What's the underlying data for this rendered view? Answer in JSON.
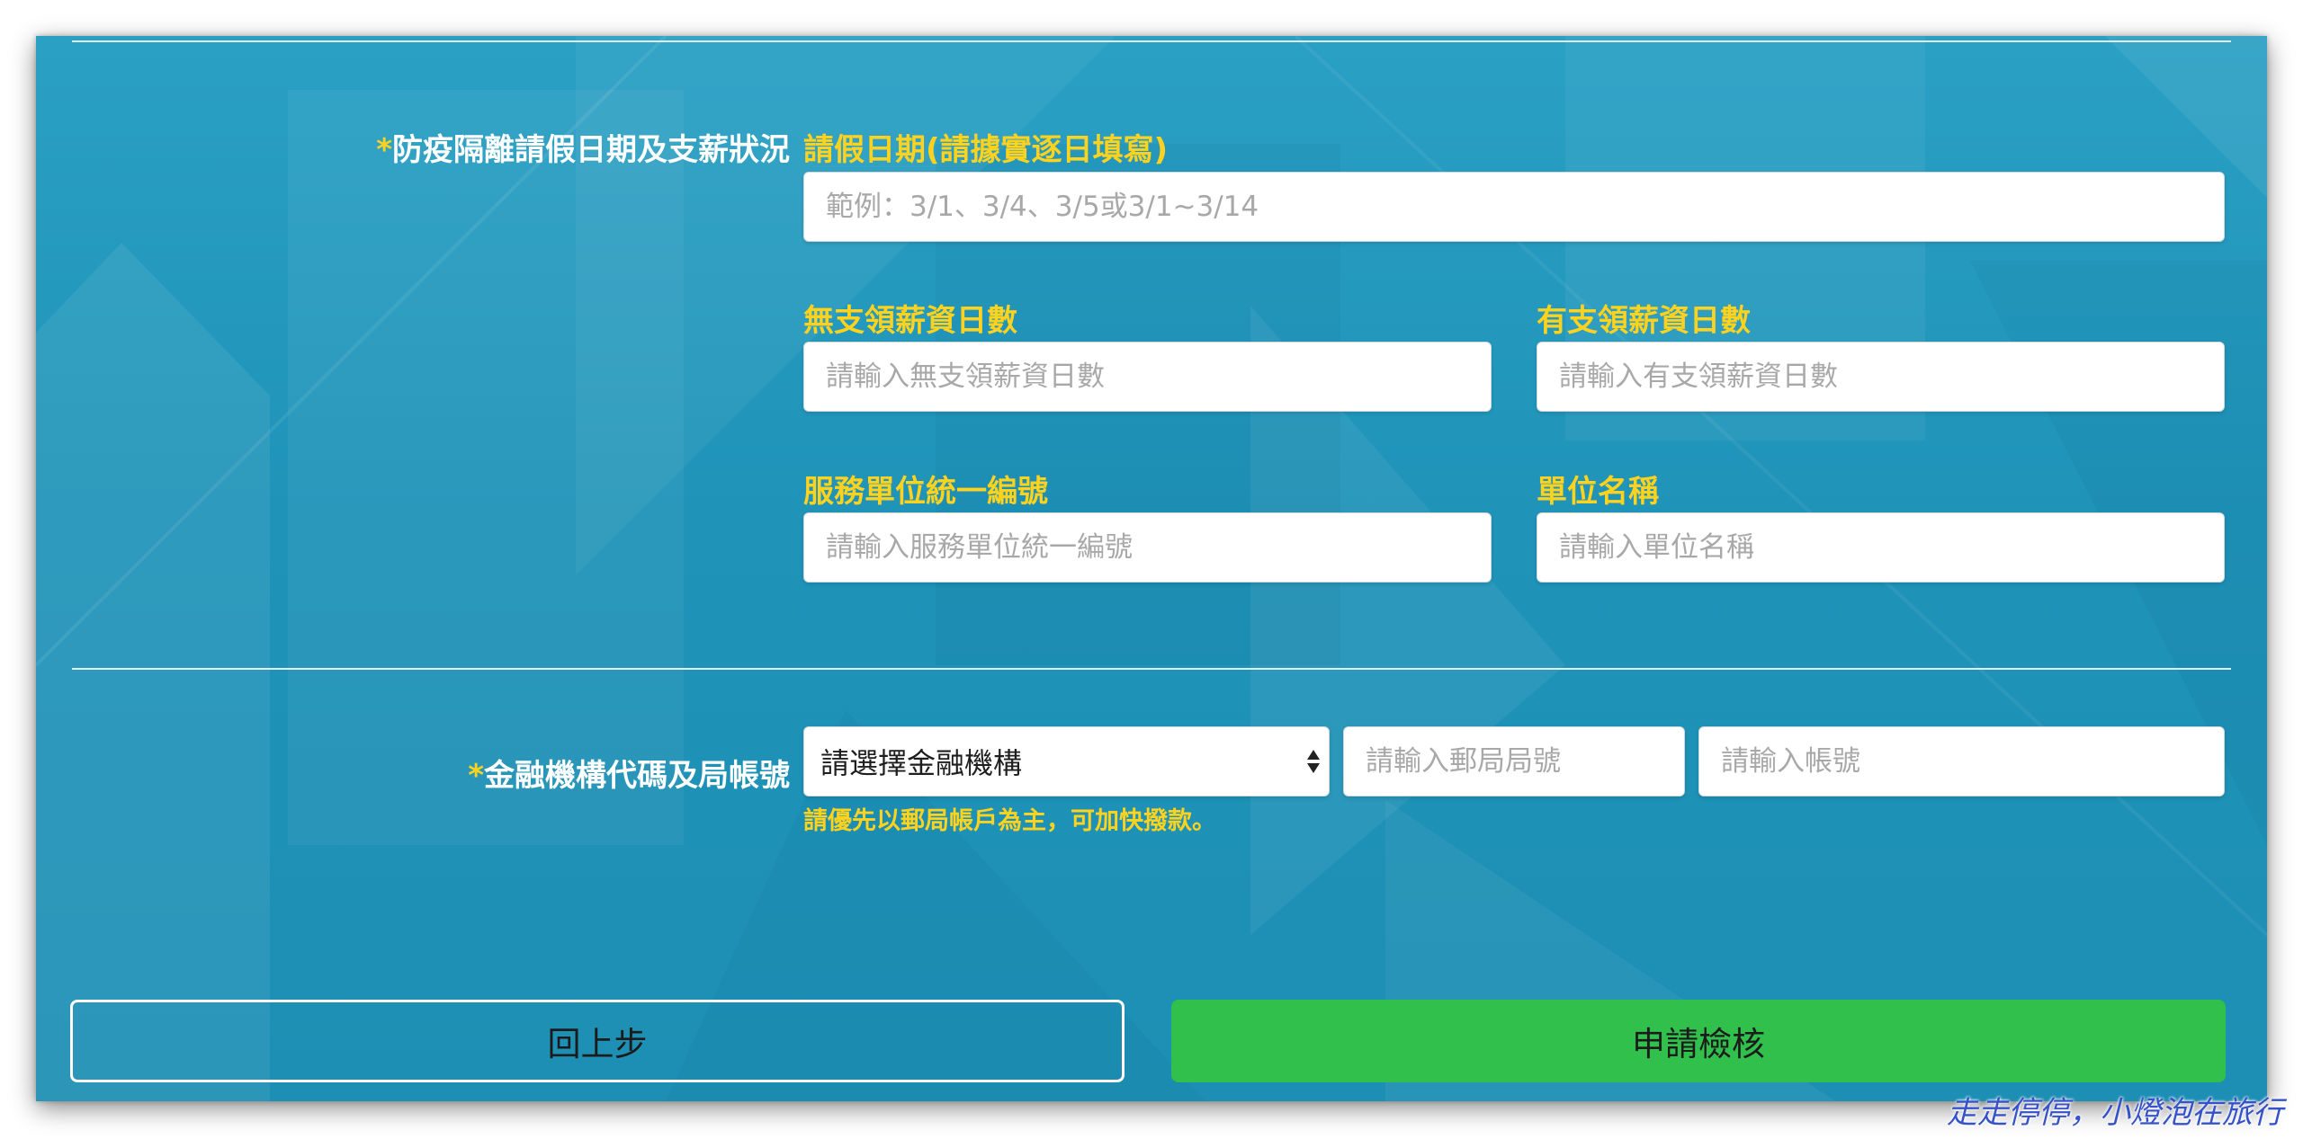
{
  "leave_section": {
    "label_star": "*",
    "label": "防疫隔離請假日期及支薪狀況",
    "dates_label": "請假日期(請據實逐日填寫)",
    "dates_placeholder": "範例：3/1、3/4、3/5或3/1~3/14",
    "unpaid_days_label": "無支領薪資日數",
    "unpaid_days_placeholder": "請輸入無支領薪資日數",
    "paid_days_label": "有支領薪資日數",
    "paid_days_placeholder": "請輸入有支領薪資日數",
    "employer_id_label": "服務單位統一編號",
    "employer_id_placeholder": "請輸入服務單位統一編號",
    "employer_name_label": "單位名稱",
    "employer_name_placeholder": "請輸入單位名稱"
  },
  "bank_section": {
    "label_star": "*",
    "label": "金融機構代碼及局帳號",
    "institution_select_value": "請選擇金融機構",
    "branch_placeholder": "請輸入郵局局號",
    "account_placeholder": "請輸入帳號",
    "hint": "請優先以郵局帳戶為主，可加快撥款。"
  },
  "buttons": {
    "back": "回上步",
    "submit": "申請檢核"
  },
  "watermark": "走走停停，小燈泡在旅行",
  "colors": {
    "panel_background": "#1f93b8",
    "label_yellow": "#ffd21e",
    "submit_green": "#30c04b",
    "watermark_blue": "#3552c8"
  }
}
